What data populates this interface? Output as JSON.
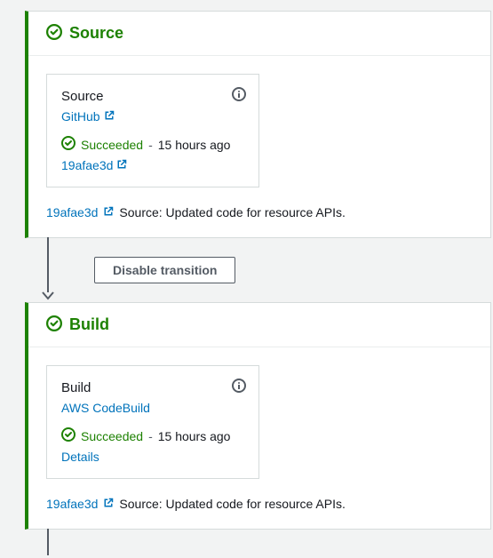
{
  "stages": [
    {
      "title": "Source",
      "action": {
        "name": "Source",
        "provider": "GitHub",
        "providerIsLink": true,
        "providerExternal": true,
        "status": "Succeeded",
        "time": "15 hours ago",
        "commit": "19afae3d",
        "detailLabel": "19afae3d",
        "detailIsCommit": true
      },
      "footer": {
        "commit": "19afae3d",
        "message": "Source: Updated code for resource APIs."
      }
    },
    {
      "title": "Build",
      "action": {
        "name": "Build",
        "provider": "AWS CodeBuild",
        "providerIsLink": true,
        "providerExternal": false,
        "status": "Succeeded",
        "time": "15 hours ago",
        "detailLabel": "Details",
        "detailIsCommit": false
      },
      "footer": {
        "commit": "19afae3d",
        "message": "Source: Updated code for resource APIs."
      }
    }
  ],
  "transition": {
    "disableLabel": "Disable transition"
  }
}
